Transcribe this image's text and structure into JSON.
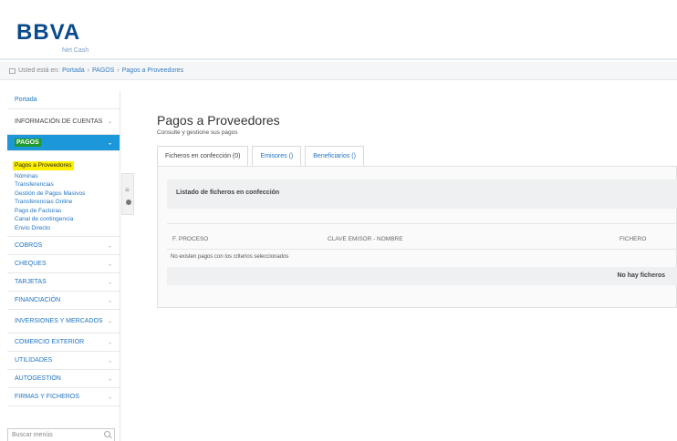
{
  "brand": {
    "logo": "BBVA",
    "sub": "Net Cash"
  },
  "breadcrumb": {
    "prefix": "Usted está en:",
    "items": [
      "Portada",
      "PAGOS",
      "Pagos a Proveedores"
    ]
  },
  "sidebar": {
    "portada": "Portada",
    "info": "INFORMACIÓN DE CUENTAS",
    "pagos": "PAGOS",
    "pagos_items": [
      "Pagos a Proveedores",
      "Nóminas",
      "Transferencias",
      "Gestión de Pagos Masivos",
      "Transferencias Online",
      "Pago de Facturas",
      "Canal de contingencia",
      "Envío Directo"
    ],
    "sections": [
      "COBROS",
      "CHEQUES",
      "TARJETAS",
      "FINANCIACIÓN",
      "INVERSIONES Y MERCADOS",
      "COMERCIO EXTERIOR",
      "UTILIDADES",
      "AUTOGESTIÓN",
      "FIRMAS Y FICHEROS"
    ],
    "search_placeholder": "Buscar menús",
    "chevron": "⌄"
  },
  "main": {
    "title": "Pagos a Proveedores",
    "subtitle": "Consulte y gestione sus pagos",
    "tabs": [
      "Ficheros en confección (0)",
      "Emisores ()",
      "Beneficiarios ()"
    ],
    "list_title": "Listado de ficheros en confección",
    "columns": [
      "F. PROCESO",
      "CLAVE EMISOR - NOMBRE",
      "FICHERO"
    ],
    "empty_message": "No existen pagos con los criterios seleccionados",
    "no_files": "No hay ficheros"
  }
}
